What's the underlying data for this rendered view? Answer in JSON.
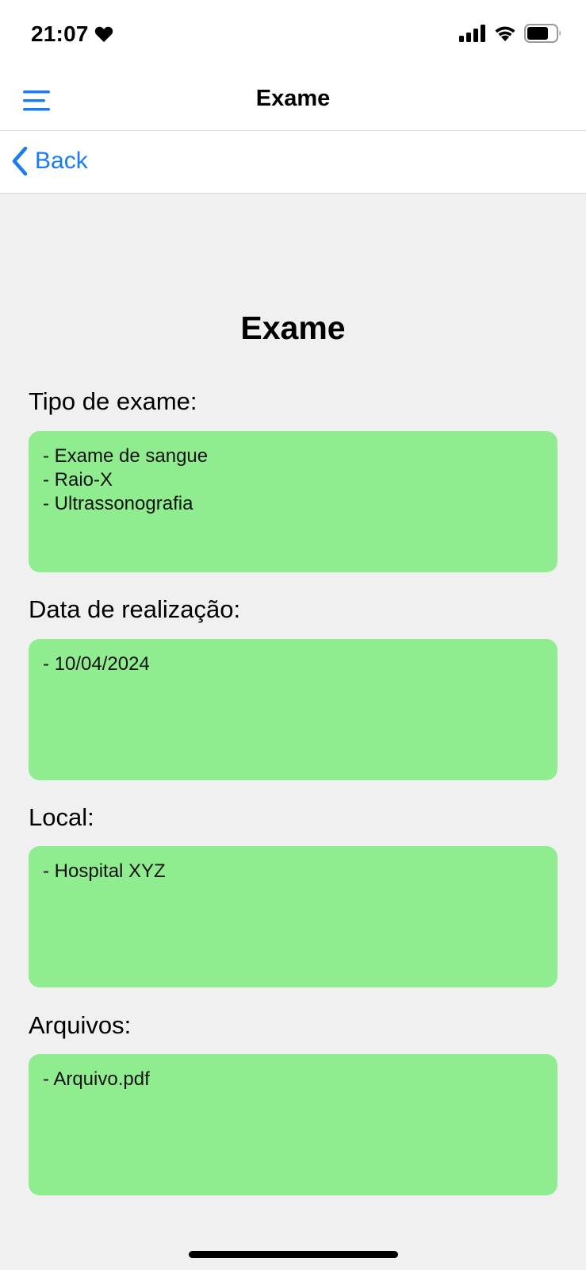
{
  "status_bar": {
    "time": "21:07",
    "icons": [
      "heart-icon",
      "signal-icon",
      "wifi-icon",
      "battery-icon"
    ]
  },
  "nav": {
    "title": "Exame",
    "menu_icon": "hamburger-menu-icon"
  },
  "back": {
    "label": "Back",
    "icon": "chevron-left-icon"
  },
  "page": {
    "title": "Exame",
    "sections": [
      {
        "label": "Tipo de exame:",
        "lines": [
          "- Exame de sangue",
          "- Raio-X",
          "- Ultrassonografia"
        ]
      },
      {
        "label": "Data de realização:",
        "lines": [
          "- 10/04/2024"
        ]
      },
      {
        "label": "Local:",
        "lines": [
          "- Hospital XYZ"
        ]
      },
      {
        "label": "Arquivos:",
        "lines": [
          "- Arquivo.pdf"
        ]
      }
    ]
  },
  "colors": {
    "accent": "#1a7cf0",
    "box_background": "#90ed8f",
    "page_background": "#f0f0f0"
  }
}
